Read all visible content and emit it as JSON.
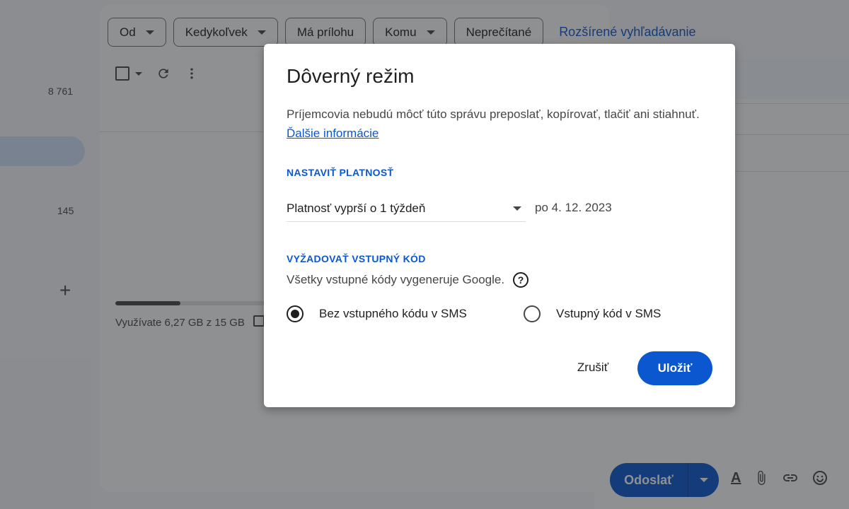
{
  "sidebar": {
    "counts": [
      "8 761",
      "145"
    ],
    "dot": "a"
  },
  "search_chips": [
    {
      "label": "Od",
      "has_caret": true
    },
    {
      "label": "Kedykoľvek",
      "has_caret": true
    },
    {
      "label": "Má prílohu",
      "has_caret": false
    },
    {
      "label": "Komu",
      "has_caret": true
    },
    {
      "label": "Neprečítané",
      "has_caret": false
    }
  ],
  "advanced_search_label": "Rozšírené vyhľadávanie",
  "toolbar": {
    "refresh_icon": "refresh-icon",
    "more_icon": "more-vert-icon"
  },
  "storage": {
    "text": "Využívate 6,27 GB z 15 GB",
    "used_fraction": 0.418
  },
  "compose": {
    "send_label": "Odoslať",
    "tools": [
      "format-text-icon",
      "attach-icon",
      "link-icon",
      "emoji-icon"
    ]
  },
  "dialog": {
    "title": "Dôverný režim",
    "description": "Príjemcovia nebudú môcť túto správu preposlať, kopírovať, tlačiť ani stiahnuť.",
    "learn_more": "Ďalšie informácie",
    "expiry_section": "NASTAVIŤ PLATNOSŤ",
    "expiry_selected": "Platnosť vyprší o 1 týždeň",
    "expiry_date": "po 4. 12. 2023",
    "passcode_section": "VYŽADOVAŤ VSTUPNÝ KÓD",
    "passcode_note": "Všetky vstupné kódy vygeneruje Google.",
    "radio_options": [
      {
        "label": "Bez vstupného kódu v SMS",
        "checked": true
      },
      {
        "label": "Vstupný kód v SMS",
        "checked": false
      }
    ],
    "cancel_label": "Zrušiť",
    "save_label": "Uložiť"
  },
  "colors": {
    "accent": "#0b57d0",
    "scrim": "rgba(32,33,36,0.5)"
  }
}
